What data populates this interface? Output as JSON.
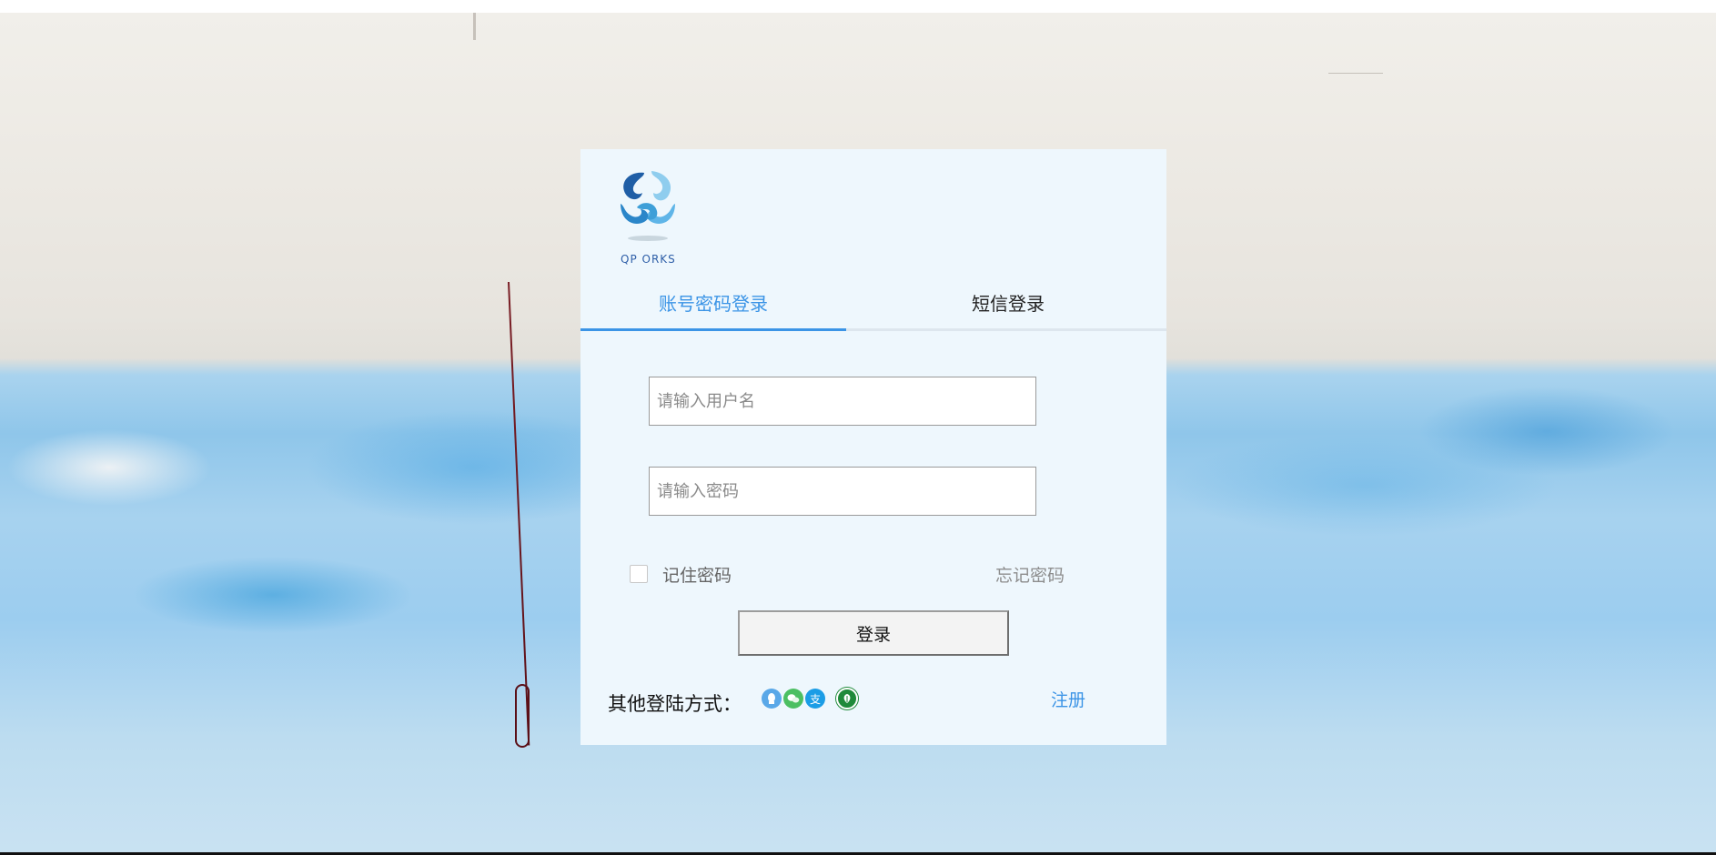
{
  "brand": {
    "logo_text": "QP  ORKS",
    "logo_colors": [
      "#1f5ea6",
      "#5fb5e8",
      "#8fcdee",
      "#2b86c9"
    ]
  },
  "tabs": [
    {
      "label": "账号密码登录",
      "active": true
    },
    {
      "label": "短信登录",
      "active": false
    }
  ],
  "form": {
    "username_placeholder": "请输入用户名",
    "password_placeholder": "请输入密码",
    "remember_label": "记住密码",
    "remember_checked": false,
    "forgot_label": "忘记密码",
    "login_label": "登录"
  },
  "footer": {
    "other_methods_label": "其他登陆方式：",
    "social_icons": [
      {
        "name": "qq-icon",
        "color": "#5aa8e8",
        "glyph": "◍"
      },
      {
        "name": "wechat-icon",
        "color": "#4cbf62",
        "glyph": "◔"
      },
      {
        "name": "alipay-icon",
        "color": "#1b9de6",
        "glyph": "支"
      },
      {
        "name": "green-leaf-icon",
        "color": "#1f8a3a",
        "glyph": "❦"
      }
    ],
    "register_label": "注册"
  },
  "colors": {
    "accent": "#3b94e6",
    "card_bg": "#eef7fd"
  }
}
